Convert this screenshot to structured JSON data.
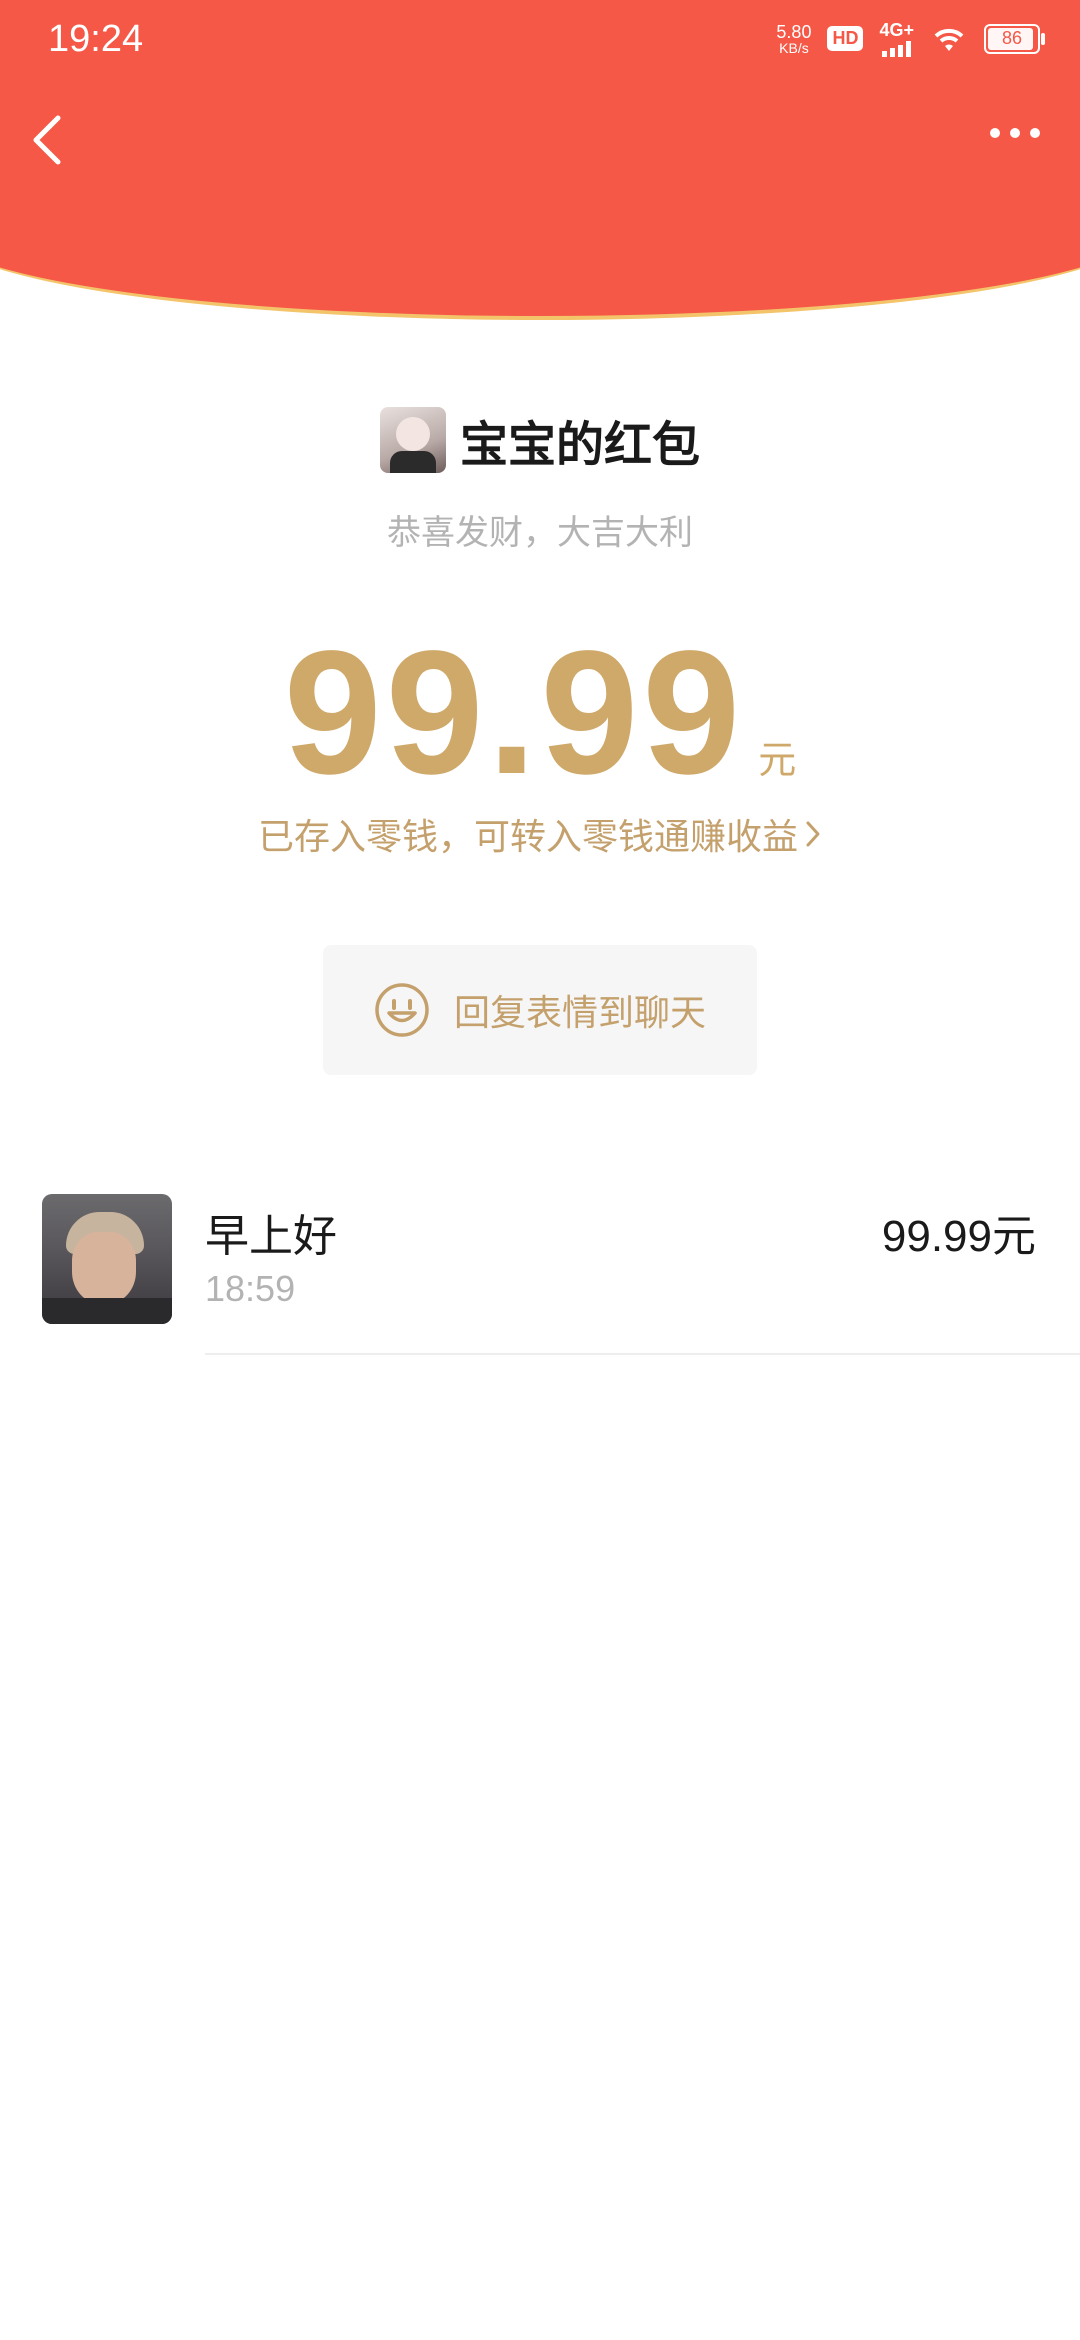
{
  "status_bar": {
    "time": "19:24",
    "net_speed_value": "5.80",
    "net_speed_unit": "KB/s",
    "hd_label": "HD",
    "network_label": "4G+",
    "battery_level": "86"
  },
  "packet": {
    "sender_name": "宝宝的红包",
    "wish": "恭喜发财，大吉大利",
    "amount": "99.99",
    "amount_unit": "元",
    "saved_text": "已存入零钱，可转入零钱通赚收益",
    "reply_label": "回复表情到聊天"
  },
  "records": [
    {
      "name": "早上好",
      "time": "18:59",
      "amount": "99.99元"
    }
  ],
  "colors": {
    "header_red": "#f55847",
    "gold": "#cfa96a",
    "gold_text": "#c4a06c"
  }
}
